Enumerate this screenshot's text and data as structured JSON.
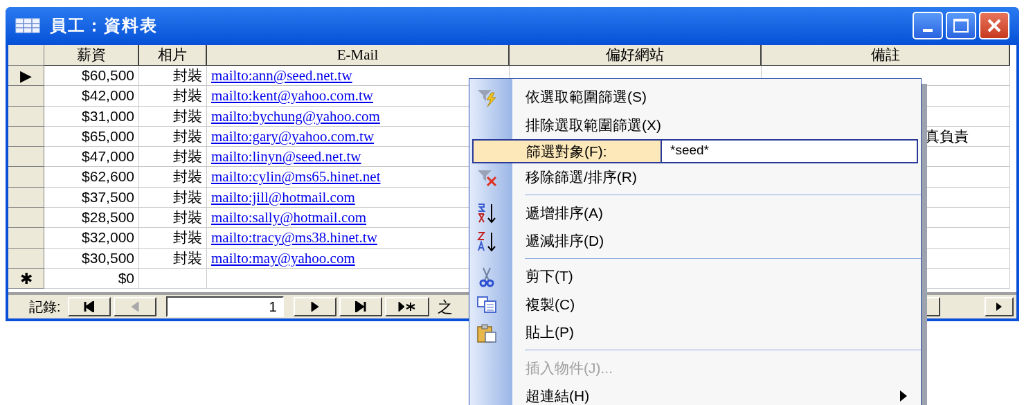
{
  "window": {
    "title": "員工：資料表"
  },
  "table": {
    "columns": [
      "薪資",
      "相片",
      "E-Mail",
      "偏好網站",
      "備註"
    ],
    "rows": [
      {
        "marker": "▶",
        "salary": "$60,500",
        "photo": "封裝",
        "email": "mailto:ann@seed.net.tw"
      },
      {
        "salary": "$42,000",
        "photo": "封裝",
        "email": "mailto:kent@yahoo.com.tw"
      },
      {
        "salary": "$31,000",
        "photo": "封裝",
        "email": "mailto:bychung@yahoo.com"
      },
      {
        "salary": "$65,000",
        "photo": "封裝",
        "email": "mailto:gary@yahoo.com.tw",
        "remark": "真負責"
      },
      {
        "salary": "$47,000",
        "photo": "封裝",
        "email": "mailto:linyn@seed.net.tw"
      },
      {
        "salary": "$62,600",
        "photo": "封裝",
        "email": "mailto:cylin@ms65.hinet.net"
      },
      {
        "salary": "$37,500",
        "photo": "封裝",
        "email": "mailto:jill@hotmail.com"
      },
      {
        "salary": "$28,500",
        "photo": "封裝",
        "email": "mailto:sally@hotmail.com"
      },
      {
        "salary": "$32,000",
        "photo": "封裝",
        "email": "mailto:tracy@ms38.hinet.tw"
      },
      {
        "salary": "$30,500",
        "photo": "封裝",
        "email": "mailto:may@yahoo.com"
      },
      {
        "marker": "✱",
        "salary": "$0"
      }
    ]
  },
  "navigation": {
    "label": "記錄:",
    "buttons": [
      {
        "kind": "first",
        "disabled": false
      },
      {
        "kind": "prev",
        "disabled": true
      }
    ],
    "current": "1",
    "buttons_after": [
      {
        "kind": "next",
        "disabled": false
      },
      {
        "kind": "last",
        "disabled": false
      },
      {
        "kind": "new",
        "disabled": false
      }
    ],
    "suffix": "之"
  },
  "context_menu": {
    "items": [
      {
        "kind": "item",
        "label": "依選取範圍篩選(S)"
      },
      {
        "kind": "item",
        "label": "排除選取範圍篩選(X)"
      },
      {
        "kind": "field",
        "label": "篩選對象(F):",
        "value": "*seed*",
        "highlighted": true
      },
      {
        "kind": "item",
        "label": "移除篩選/排序(R)"
      },
      {
        "kind": "separator"
      },
      {
        "kind": "item",
        "label": "遞增排序(A)"
      },
      {
        "kind": "item",
        "label": "遞減排序(D)"
      },
      {
        "kind": "separator"
      },
      {
        "kind": "item",
        "label": "剪下(T)"
      },
      {
        "kind": "item",
        "label": "複製(C)"
      },
      {
        "kind": "item",
        "label": "貼上(P)"
      },
      {
        "kind": "separator"
      },
      {
        "kind": "item",
        "label": "插入物件(J)...",
        "disabled": true
      },
      {
        "kind": "item",
        "label": "超連結(H)",
        "submenu": true
      }
    ]
  }
}
